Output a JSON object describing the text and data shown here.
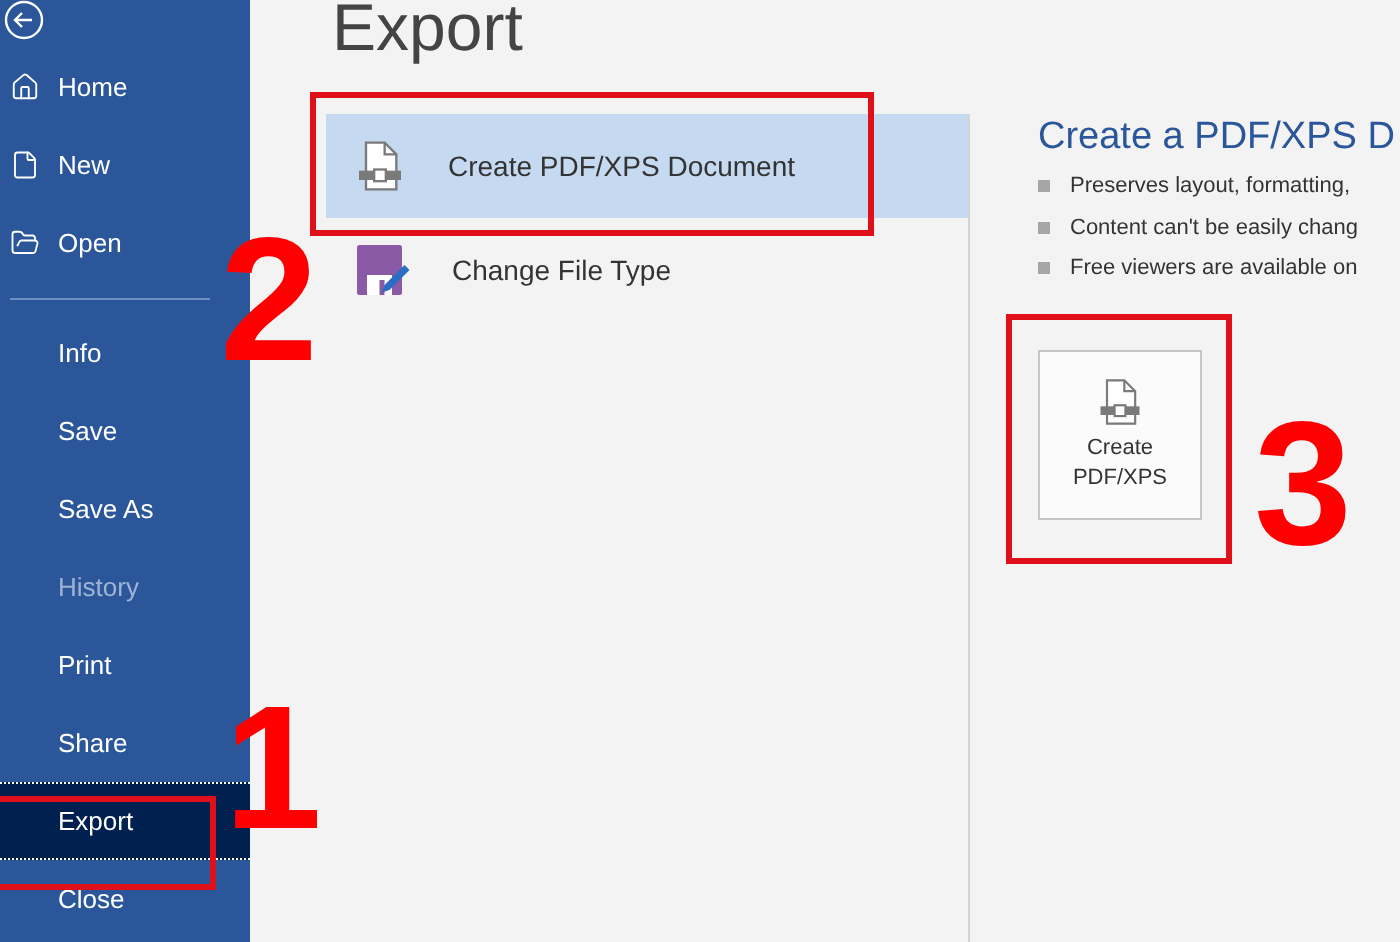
{
  "page_title": "Export",
  "sidebar": {
    "sections": [
      {
        "items": [
          {
            "label": "Home",
            "kind": "home",
            "selected": false,
            "disabled": false
          },
          {
            "label": "New",
            "kind": "new",
            "selected": false,
            "disabled": false
          },
          {
            "label": "Open",
            "kind": "open",
            "selected": false,
            "disabled": false
          }
        ]
      },
      {
        "items": [
          {
            "label": "Info",
            "kind": "plain",
            "selected": false,
            "disabled": false
          },
          {
            "label": "Save",
            "kind": "plain",
            "selected": false,
            "disabled": false
          },
          {
            "label": "Save As",
            "kind": "plain",
            "selected": false,
            "disabled": false
          },
          {
            "label": "History",
            "kind": "plain",
            "selected": false,
            "disabled": true
          },
          {
            "label": "Print",
            "kind": "plain",
            "selected": false,
            "disabled": false
          },
          {
            "label": "Share",
            "kind": "plain",
            "selected": false,
            "disabled": false
          },
          {
            "label": "Export",
            "kind": "plain",
            "selected": true,
            "disabled": false
          },
          {
            "label": "Close",
            "kind": "plain",
            "selected": false,
            "disabled": false
          }
        ]
      }
    ]
  },
  "export_options": [
    {
      "label": "Create PDF/XPS Document",
      "kind": "pdf",
      "selected": true
    },
    {
      "label": "Change File Type",
      "kind": "filetype",
      "selected": false
    }
  ],
  "detail": {
    "heading": "Create a PDF/XPS D",
    "bullets": [
      "Preserves layout, formatting,",
      "Content can't be easily chang",
      "Free viewers are available on"
    ],
    "button_label": [
      "Create",
      "PDF/XPS"
    ]
  },
  "annotations": [
    "1",
    "2",
    "3"
  ]
}
